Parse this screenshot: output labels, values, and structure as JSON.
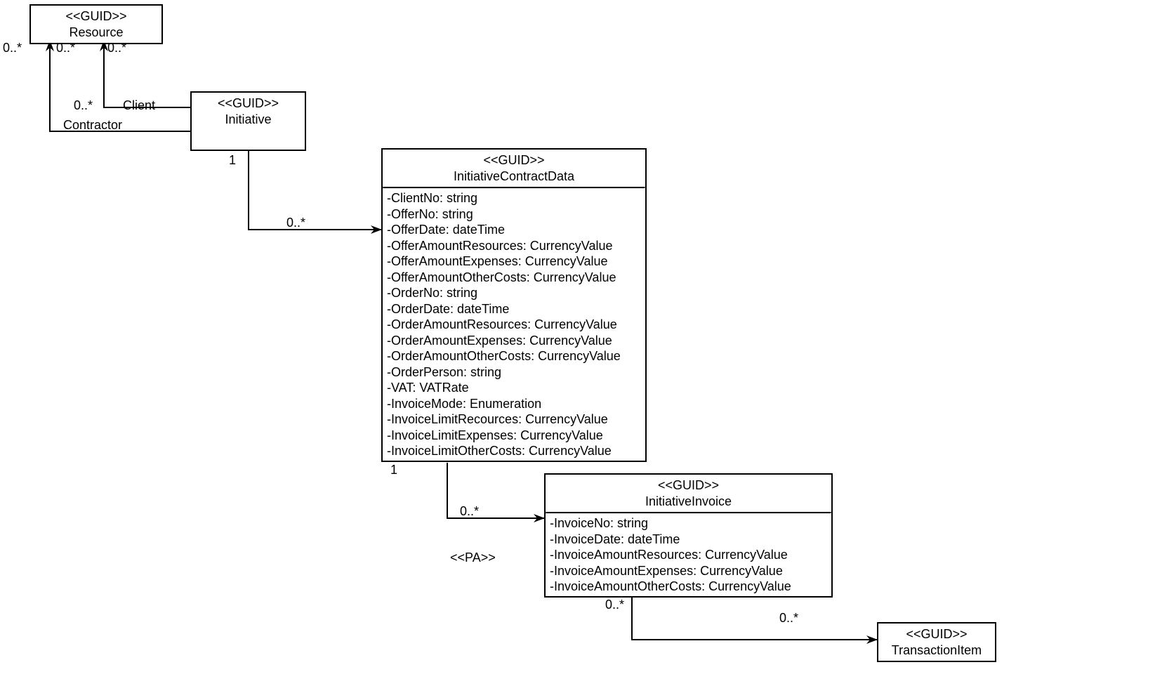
{
  "classes": {
    "resource": {
      "stereotype": "<<GUID>>",
      "name": "Resource"
    },
    "initiative": {
      "stereotype": "<<GUID>>",
      "name": "Initiative"
    },
    "contractData": {
      "stereotype": "<<GUID>>",
      "name": "InitiativeContractData",
      "attrs": [
        "-ClientNo: string",
        "-OfferNo: string",
        "-OfferDate: dateTime",
        "-OfferAmountResources: CurrencyValue",
        "-OfferAmountExpenses: CurrencyValue",
        "-OfferAmountOtherCosts: CurrencyValue",
        "-OrderNo: string",
        "-OrderDate: dateTime",
        "-OrderAmountResources: CurrencyValue",
        "-OrderAmountExpenses: CurrencyValue",
        "-OrderAmountOtherCosts: CurrencyValue",
        "-OrderPerson: string",
        "-VAT: VATRate",
        "-InvoiceMode: Enumeration",
        "-InvoiceLimitRecources: CurrencyValue",
        "-InvoiceLimitExpenses: CurrencyValue",
        "-InvoiceLimitOtherCosts: CurrencyValue"
      ]
    },
    "invoice": {
      "stereotype": "<<GUID>>",
      "name": "InitiativeInvoice",
      "attrs": [
        "-InvoiceNo: string",
        "-InvoiceDate: dateTime",
        "-InvoiceAmountResources: CurrencyValue",
        "-InvoiceAmountExpenses: CurrencyValue",
        "-InvoiceAmountOtherCosts: CurrencyValue"
      ]
    },
    "transactionItem": {
      "stereotype": "<<GUID>>",
      "name": "TransactionItem"
    }
  },
  "labels": {
    "m_resource_self": "0..*",
    "m_resource_left": "0..*",
    "m_resource_right": "0..*",
    "m_client_top": "0..*",
    "role_client": "Client",
    "role_contractor": "Contractor",
    "m_initiative_one": "1",
    "m_contract_many": "0..*",
    "m_contract_one": "1",
    "m_invoice_many": "0..*",
    "pa_stereo": "<<PA>>",
    "m_invoice_bottom_left": "0..*",
    "m_invoice_bottom_right": "0..*"
  }
}
